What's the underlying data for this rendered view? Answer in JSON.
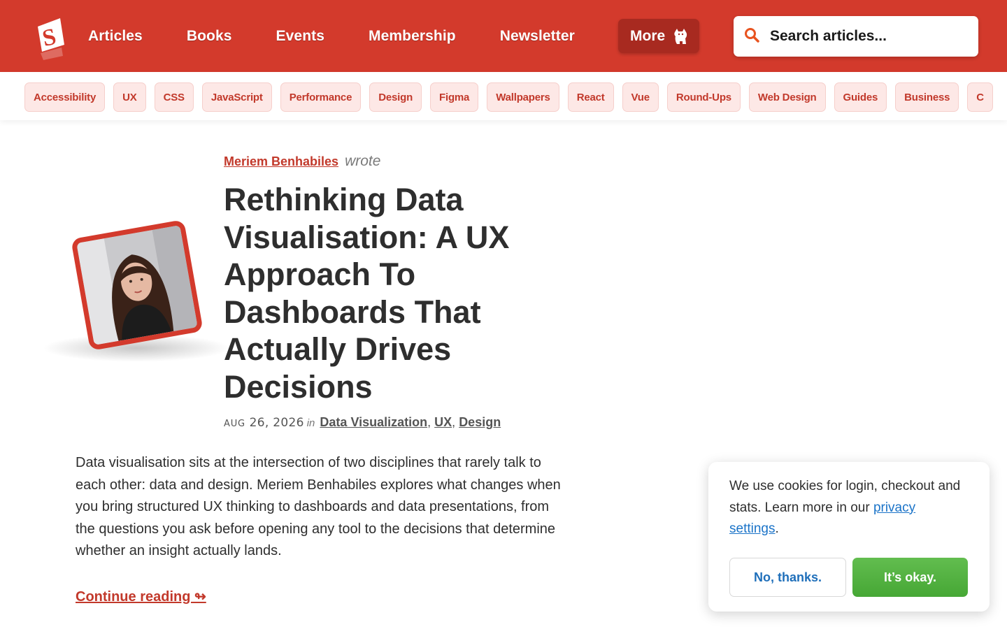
{
  "colors": {
    "brand": "#d33a2c",
    "tag_bg": "#fde8e6",
    "accept": "#4caf3a",
    "link_blue": "#1a73c8"
  },
  "header": {
    "logo_icon": "smashing-logo-icon",
    "nav": [
      "Articles",
      "Books",
      "Events",
      "Membership",
      "Newsletter"
    ],
    "more_label": "More",
    "more_icon": "cat-icon",
    "search_placeholder": "Search articles...",
    "search_icon": "search-icon"
  },
  "tags": [
    "Accessibility",
    "UX",
    "CSS",
    "JavaScript",
    "Performance",
    "Design",
    "Figma",
    "Wallpapers",
    "React",
    "Vue",
    "Round-Ups",
    "Web Design",
    "Guides",
    "Business",
    "C"
  ],
  "article": {
    "author": "Meriem Benhabiles",
    "wrote": "wrote",
    "title": "Rethinking Data Visualisation: A UX Approach To Dashboards That Actually Drives Decisions",
    "date_month": "Aug",
    "date_rest": "26, 2026",
    "in_label": "in",
    "categories": [
      "Data Visualization",
      "UX",
      "Design"
    ],
    "excerpt": "Data visualisation sits at the intersection of two disciplines that rarely talk to each other: data and design. Meriem Benhabiles explores what changes when you bring structured UX thinking to dashboards and data presentations, from the questions you ask before opening any tool to the decisions that determine whether an insight actually lands.",
    "continue_label": "Continue reading ↬"
  },
  "cookie": {
    "text_before": "We use cookies for login, checkout and stats. Learn more in our ",
    "link_label": "privacy settings",
    "text_after": ".",
    "decline_label": "No, thanks.",
    "accept_label": "It’s okay."
  }
}
